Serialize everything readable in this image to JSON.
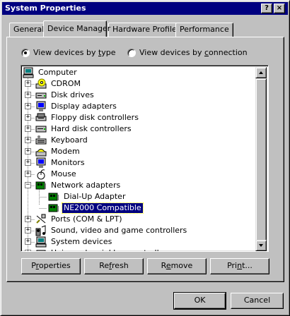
{
  "window": {
    "title": "System Properties",
    "help_glyph": "?",
    "close_glyph": "×"
  },
  "tabs": [
    {
      "label": "General",
      "active": false
    },
    {
      "label": "Device Manager",
      "active": true
    },
    {
      "label": "Hardware Profiles",
      "active": false
    },
    {
      "label": "Performance",
      "active": false
    }
  ],
  "view_options": {
    "by_type": {
      "prefix": "View devices by ",
      "accel": "t",
      "suffix": "ype",
      "selected": true
    },
    "by_connection": {
      "prefix": "View devices by ",
      "accel": "c",
      "suffix": "onnection",
      "selected": false
    }
  },
  "tree": {
    "root": {
      "label": "Computer",
      "icon": "computer-icon"
    },
    "items": [
      {
        "label": "CDROM",
        "icon": "cdrom-icon",
        "expander": "+"
      },
      {
        "label": "Disk drives",
        "icon": "disk-drive-icon",
        "expander": "+"
      },
      {
        "label": "Display adapters",
        "icon": "display-adapter-icon",
        "expander": "+"
      },
      {
        "label": "Floppy disk controllers",
        "icon": "floppy-controller-icon",
        "expander": "+"
      },
      {
        "label": "Hard disk controllers",
        "icon": "hard-disk-controller-icon",
        "expander": "+"
      },
      {
        "label": "Keyboard",
        "icon": "keyboard-icon",
        "expander": "+"
      },
      {
        "label": "Modem",
        "icon": "modem-icon",
        "expander": "+"
      },
      {
        "label": "Monitors",
        "icon": "monitor-icon",
        "expander": "+"
      },
      {
        "label": "Mouse",
        "icon": "mouse-icon",
        "expander": "+"
      },
      {
        "label": "Network adapters",
        "icon": "network-adapter-icon",
        "expander": "−"
      },
      {
        "label": "Dial-Up Adapter",
        "icon": "network-card-icon",
        "child": true
      },
      {
        "label": "NE2000 Compatible",
        "icon": "network-card-icon",
        "child": true,
        "selected": true
      },
      {
        "label": "Ports (COM & LPT)",
        "icon": "port-icon",
        "expander": "+"
      },
      {
        "label": "Sound, video and game controllers",
        "icon": "sound-icon",
        "expander": "+"
      },
      {
        "label": "System devices",
        "icon": "system-device-icon",
        "expander": "+"
      },
      {
        "label": "Universal serial bus controller",
        "icon": "usb-icon",
        "expander": "+"
      }
    ]
  },
  "actions": {
    "properties": {
      "accel": "r",
      "pre": "P",
      "post": "operties"
    },
    "refresh": {
      "accel": "f",
      "pre": "Re",
      "post": "resh"
    },
    "remove": {
      "accel": "e",
      "pre": "R",
      "post": "move"
    },
    "print": {
      "accel": "n",
      "pre": "Pri",
      "post": "t..."
    }
  },
  "dialog_buttons": {
    "ok": "OK",
    "cancel": "Cancel"
  },
  "colors": {
    "selection": "#000080",
    "title_bar": "#000080",
    "face": "#c0c0c0"
  }
}
